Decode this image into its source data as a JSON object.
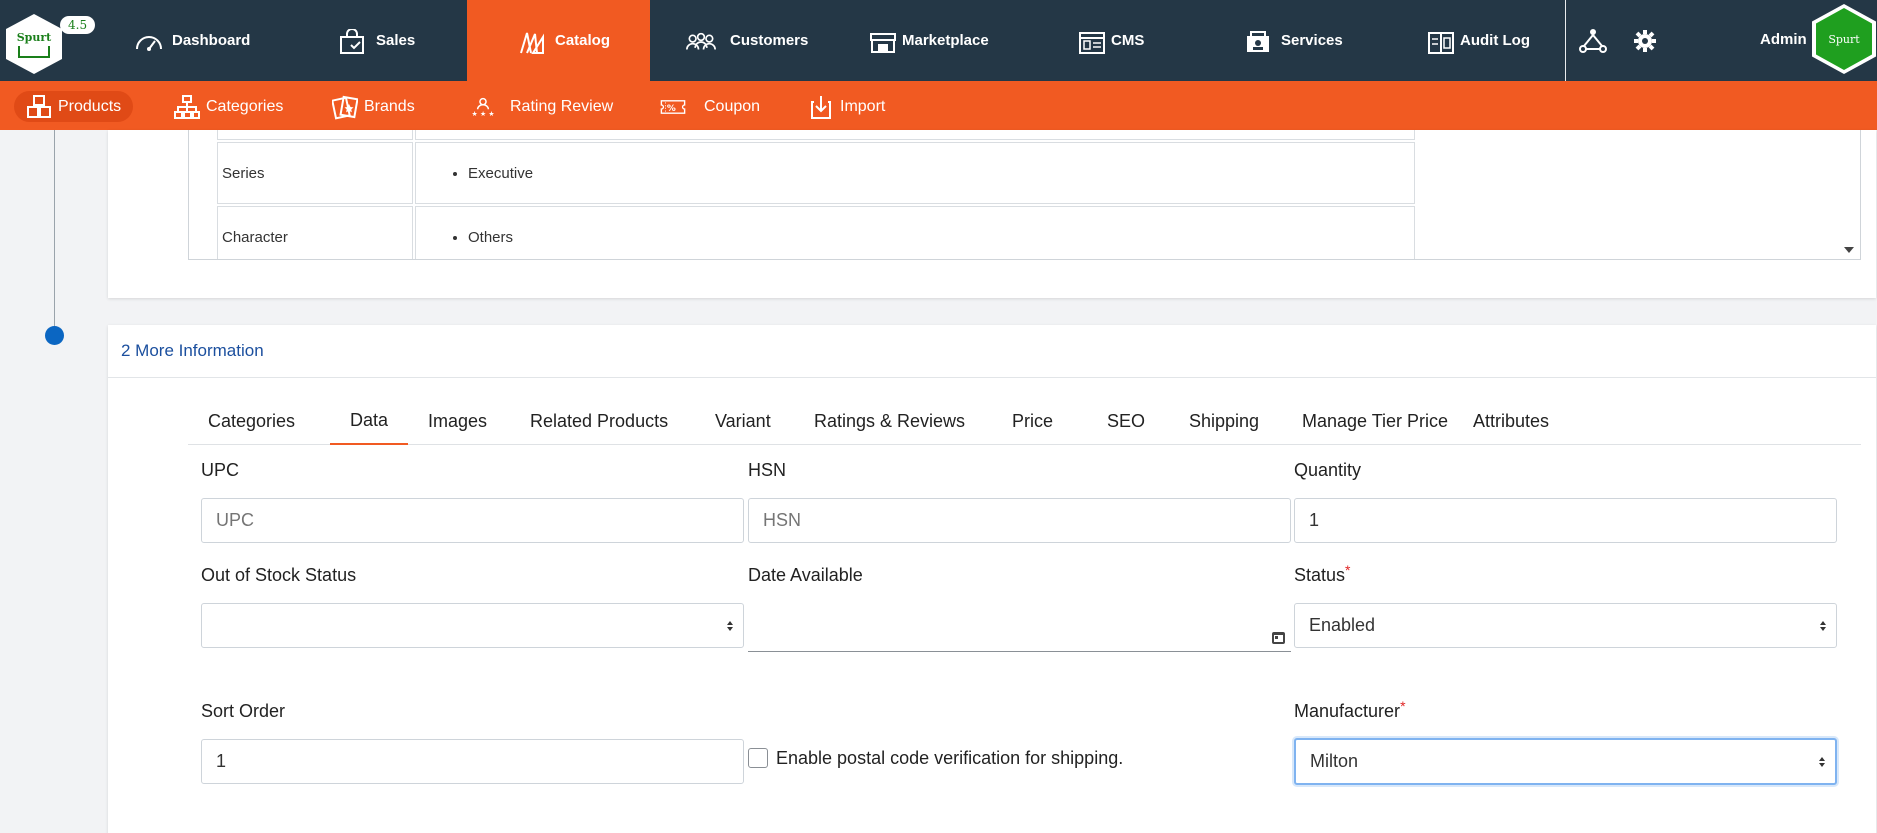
{
  "app": {
    "logo_text": "Spurt",
    "version": "4.5",
    "admin_label": "Admin",
    "avatar_text": "Spurt"
  },
  "topnav": {
    "items": [
      {
        "label": "Dashboard",
        "icon": "speedometer-icon"
      },
      {
        "label": "Sales",
        "icon": "shopping-bag-icon"
      },
      {
        "label": "Catalog",
        "icon": "catalog-icon",
        "active": true
      },
      {
        "label": "Customers",
        "icon": "customers-icon"
      },
      {
        "label": "Marketplace",
        "icon": "marketplace-icon"
      },
      {
        "label": "CMS",
        "icon": "cms-icon"
      },
      {
        "label": "Services",
        "icon": "services-icon"
      },
      {
        "label": "Audit Log",
        "icon": "audit-log-icon"
      }
    ]
  },
  "subnav": {
    "items": [
      {
        "label": "Products",
        "icon": "products-icon",
        "active": true
      },
      {
        "label": "Categories",
        "icon": "categories-icon"
      },
      {
        "label": "Brands",
        "icon": "brands-icon"
      },
      {
        "label": "Rating Review",
        "icon": "rating-review-icon"
      },
      {
        "label": "Coupon",
        "icon": "coupon-icon"
      },
      {
        "label": "Import",
        "icon": "import-icon"
      }
    ]
  },
  "specs": {
    "rows": [
      {
        "key": "",
        "value": ""
      },
      {
        "key": "Series",
        "value": "Executive"
      },
      {
        "key": "Character",
        "value": "Others"
      }
    ]
  },
  "more_info": {
    "title": "2 More Information",
    "tabs": [
      "Categories",
      "Data",
      "Images",
      "Related Products",
      "Variant",
      "Ratings & Reviews",
      "Price",
      "SEO",
      "Shipping",
      "Manage Tier Price",
      "Attributes"
    ],
    "active_tab": "Data"
  },
  "form": {
    "upc": {
      "label": "UPC",
      "value": "",
      "placeholder": "UPC"
    },
    "hsn": {
      "label": "HSN",
      "value": "",
      "placeholder": "HSN"
    },
    "quantity": {
      "label": "Quantity",
      "value": "1"
    },
    "out_of_stock": {
      "label": "Out of Stock Status",
      "value": ""
    },
    "date_available": {
      "label": "Date Available",
      "value": ""
    },
    "status": {
      "label": "Status",
      "required_mark": "*",
      "value": "Enabled"
    },
    "sort_order": {
      "label": "Sort Order",
      "value": "1"
    },
    "postal_check": {
      "label": "Enable postal code verification for shipping.",
      "checked": false
    },
    "manufacturer": {
      "label": "Manufacturer",
      "required_mark": "*",
      "value": "Milton"
    }
  }
}
